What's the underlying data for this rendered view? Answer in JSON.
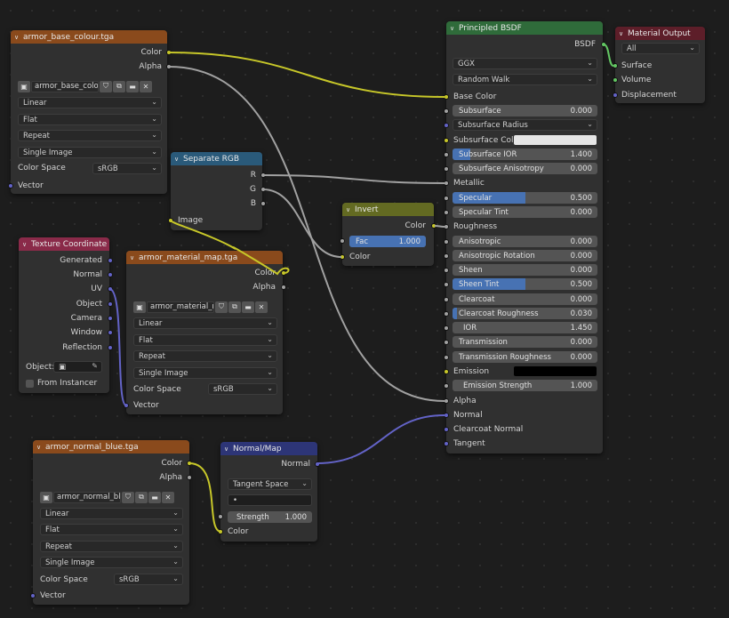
{
  "nodes": {
    "base_colour": {
      "title": "armor_base_colour.tga",
      "out_color": "Color",
      "out_alpha": "Alpha",
      "image_name": "armor_base_colou...",
      "interpolation": "Linear",
      "projection": "Flat",
      "extension": "Repeat",
      "source": "Single Image",
      "color_space_label": "Color Space",
      "color_space": "sRGB",
      "in_vector": "Vector"
    },
    "separate_rgb": {
      "title": "Separate RGB",
      "out_r": "R",
      "out_g": "G",
      "out_b": "B",
      "in_image": "Image"
    },
    "texture_coord": {
      "title": "Texture Coordinate",
      "outputs": [
        "Generated",
        "Normal",
        "UV",
        "Object",
        "Camera",
        "Window",
        "Reflection"
      ],
      "object_label": "Object:",
      "from_instancer": "From Instancer"
    },
    "material_map": {
      "title": "armor_material_map.tga",
      "out_color": "Color",
      "out_alpha": "Alpha",
      "image_name": "armor_material_m...",
      "interpolation": "Linear",
      "projection": "Flat",
      "extension": "Repeat",
      "source": "Single Image",
      "color_space_label": "Color Space",
      "color_space": "sRGB",
      "in_vector": "Vector"
    },
    "invert": {
      "title": "Invert",
      "out_color": "Color",
      "fac_label": "Fac",
      "fac_value": "1.000",
      "in_color": "Color"
    },
    "normal_blue": {
      "title": "armor_normal_blue.tga",
      "out_color": "Color",
      "out_alpha": "Alpha",
      "image_name": "armor_normal_blu...",
      "interpolation": "Linear",
      "projection": "Flat",
      "extension": "Repeat",
      "source": "Single Image",
      "color_space_label": "Color Space",
      "color_space": "sRGB",
      "in_vector": "Vector"
    },
    "normal_map": {
      "title": "Normal/Map",
      "out_normal": "Normal",
      "space": "Tangent Space",
      "uv_field": "•",
      "strength_label": "Strength",
      "strength_value": "1.000",
      "in_color": "Color"
    },
    "bsdf": {
      "title": "Principled BSDF",
      "out_bsdf": "BSDF",
      "distribution": "GGX",
      "subsurface_method": "Random Walk",
      "base_color": "Base Color",
      "subsurface": {
        "label": "Subsurface",
        "value": "0.000"
      },
      "subsurface_radius": "Subsurface Radius",
      "subsurface_color": "Subsurface Colo",
      "subsurface_ior": {
        "label": "Subsurface IOR",
        "value": "1.400",
        "fill": 0.12
      },
      "subsurface_anisotropy": {
        "label": "Subsurface Anisotropy",
        "value": "0.000"
      },
      "metallic": "Metallic",
      "specular": {
        "label": "Specular",
        "value": "0.500",
        "fill": 0.5
      },
      "specular_tint": {
        "label": "Specular Tint",
        "value": "0.000"
      },
      "roughness": "Roughness",
      "anisotropic": {
        "label": "Anisotropic",
        "value": "0.000"
      },
      "anisotropic_rotation": {
        "label": "Anisotropic Rotation",
        "value": "0.000"
      },
      "sheen": {
        "label": "Sheen",
        "value": "0.000"
      },
      "sheen_tint": {
        "label": "Sheen Tint",
        "value": "0.500",
        "fill": 0.5
      },
      "clearcoat": {
        "label": "Clearcoat",
        "value": "0.000"
      },
      "clearcoat_roughness": {
        "label": "Clearcoat Roughness",
        "value": "0.030",
        "fill": 0.03
      },
      "ior": {
        "label": "IOR",
        "value": "1.450"
      },
      "transmission": {
        "label": "Transmission",
        "value": "0.000"
      },
      "transmission_roughness": {
        "label": "Transmission Roughness",
        "value": "0.000"
      },
      "emission": "Emission",
      "emission_strength": {
        "label": "Emission Strength",
        "value": "1.000"
      },
      "alpha": "Alpha",
      "normal": "Normal",
      "clearcoat_normal": "Clearcoat Normal",
      "tangent": "Tangent"
    },
    "material_output": {
      "title": "Material Output",
      "target": "All",
      "surface": "Surface",
      "volume": "Volume",
      "displacement": "Displacement"
    }
  },
  "colors": {
    "socket_color": "#c7c729",
    "socket_float": "#a1a1a1",
    "socket_vector": "#6363c7",
    "socket_shader": "#63c763",
    "slider_fill": "#4772b3",
    "subsurface_color_swatch": "#e6e6e6",
    "emission_swatch": "#000000"
  }
}
